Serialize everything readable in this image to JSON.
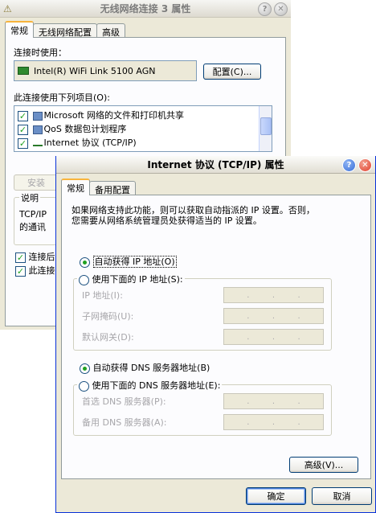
{
  "back_window": {
    "title": "无线网络连接 3 属性",
    "tabs": [
      "常规",
      "无线网络配置",
      "高级"
    ],
    "connect_using_label": "连接时使用：",
    "adapter_name": "Intel(R) WiFi Link 5100 AGN",
    "configure_button": "配置(C)...",
    "items_label": "此连接使用下列项目(O):",
    "items": [
      {
        "label": "Microsoft 网络的文件和打印机共享",
        "checked": true
      },
      {
        "label": "QoS 数据包计划程序",
        "checked": true
      },
      {
        "label": "Internet 协议 (TCP/IP)",
        "checked": true
      }
    ],
    "install_button": "安装",
    "description_label": "说明",
    "description_text_1": "TCP/IP",
    "description_text_2": "的通讯",
    "checkbox_1": "连接后",
    "checkbox_2": "此连接"
  },
  "front_window": {
    "title": "Internet 协议 (TCP/IP) 属性",
    "tabs": [
      "常规",
      "备用配置"
    ],
    "intro_line_1": "如果网络支持此功能，则可以获取自动指派的 IP 设置。否则，",
    "intro_line_2": "您需要从网络系统管理员处获得适当的 IP 设置。",
    "radio_auto_ip": "自动获得 IP 地址(O)",
    "radio_manual_ip": "使用下面的 IP 地址(S):",
    "ip_address_label": "IP 地址(I):",
    "subnet_label": "子网掩码(U):",
    "gateway_label": "默认网关(D):",
    "radio_auto_dns": "自动获得 DNS 服务器地址(B)",
    "radio_manual_dns": "使用下面的 DNS 服务器地址(E):",
    "preferred_dns_label": "首选 DNS 服务器(P):",
    "alternate_dns_label": "备用 DNS 服务器(A):",
    "advanced_button": "高级(V)...",
    "ok_button": "确定",
    "cancel_button": "取消",
    "selected_ip_mode": "auto",
    "selected_dns_mode": "auto"
  },
  "colors": {
    "window_bg": "#ece9d8",
    "panel_bg": "#fcfcfe",
    "tab_highlight": "#f8b43c",
    "check_green": "#21a121",
    "close_red": "#e0412e",
    "help_blue": "#3a6fd8"
  }
}
